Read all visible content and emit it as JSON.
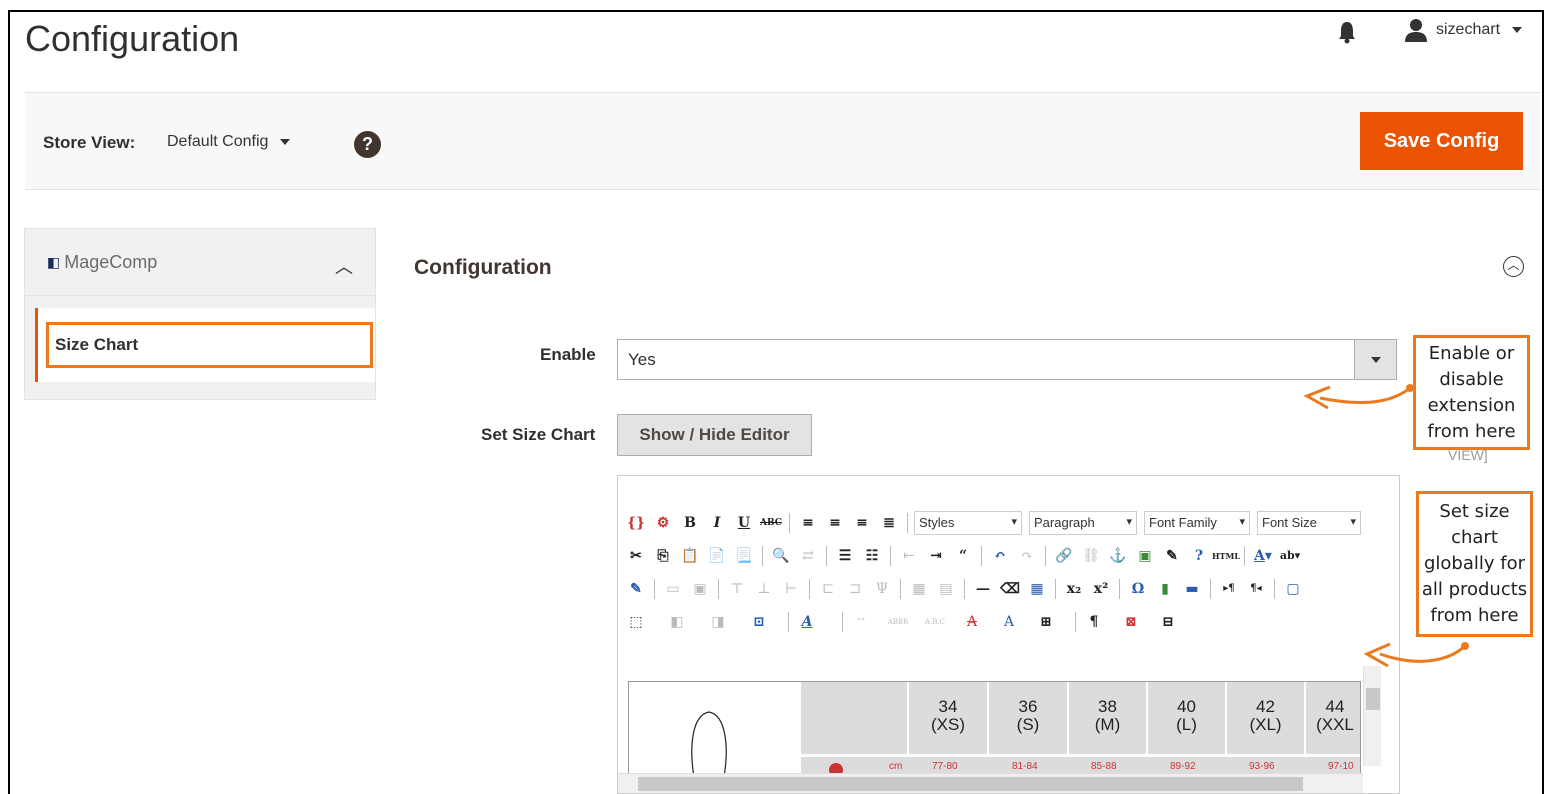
{
  "header": {
    "title": "Configuration",
    "username": "sizechart"
  },
  "store_bar": {
    "label": "Store View:",
    "selected": "Default Config",
    "help": "?",
    "save_label": "Save Config"
  },
  "sidebar": {
    "brand": "MageComp",
    "items": [
      {
        "label": "Size Chart"
      }
    ]
  },
  "main": {
    "section_title": "Configuration",
    "enable_label": "Enable",
    "enable_value": "Yes",
    "size_chart_label": "Set Size Chart",
    "editor_button": "Show / Hide Editor",
    "view_note": "VIEW]"
  },
  "editor": {
    "dropdowns": [
      "Styles",
      "Paragraph",
      "Font Family",
      "Font Size"
    ],
    "table_headers": [
      {
        "size": "34",
        "code": "(XS)"
      },
      {
        "size": "36",
        "code": "(S)"
      },
      {
        "size": "38",
        "code": "(M)"
      },
      {
        "size": "40",
        "code": "(L)"
      },
      {
        "size": "42",
        "code": "(XL)"
      },
      {
        "size": "44",
        "code": "(XXL"
      }
    ],
    "row_values": [
      "cm",
      "77-80",
      "81-84",
      "85-88",
      "89-92",
      "93-96",
      "97-10"
    ]
  },
  "callouts": {
    "enable": "Enable or disable extension from here",
    "size_chart": "Set size chart globally for all products from here"
  },
  "colors": {
    "accent": "#eb5202",
    "annotation": "#eb7a1e"
  }
}
